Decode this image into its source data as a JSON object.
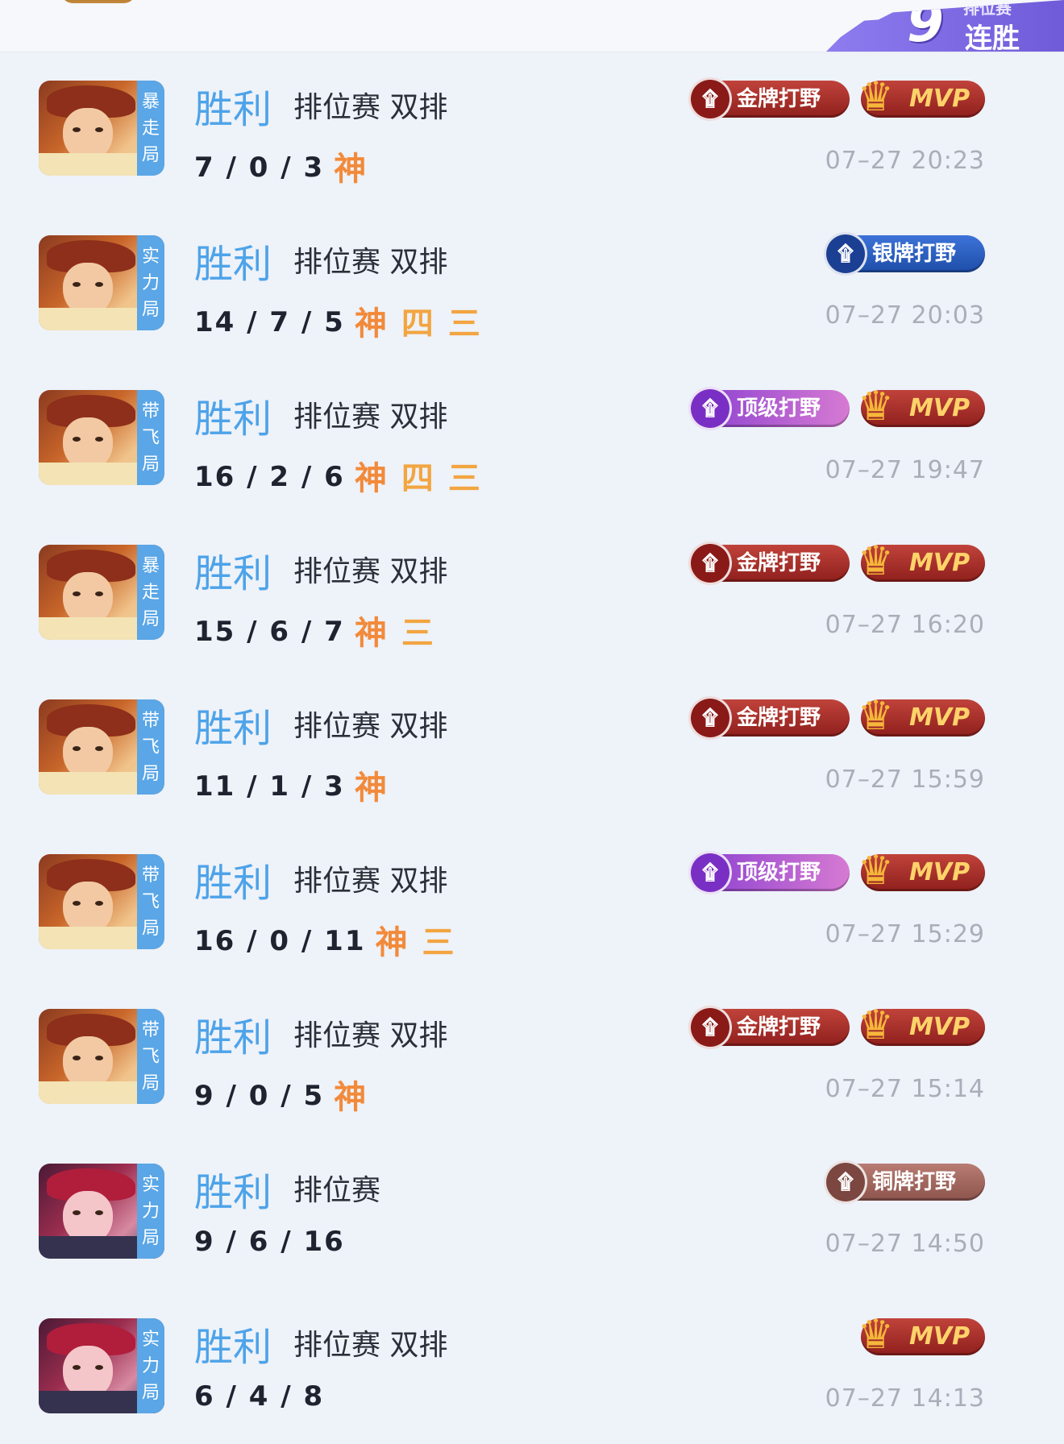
{
  "streak": {
    "number": "9",
    "sub": "排位赛",
    "label": "连胜"
  },
  "matches": [
    {
      "tag": [
        "暴",
        "走",
        "局"
      ],
      "hero": "gold",
      "result": "胜利",
      "mode": "排位赛 双排",
      "kda": "7 / 0 / 3",
      "extra": [
        "神"
      ],
      "badge": {
        "type": "gold",
        "label": "金牌打野"
      },
      "mvp": true,
      "time": "07–27 20:23"
    },
    {
      "tag": [
        "实",
        "力",
        "局"
      ],
      "hero": "gold",
      "result": "胜利",
      "mode": "排位赛 双排",
      "kda": "14 / 7 / 5",
      "extra": [
        "神",
        "四",
        "三"
      ],
      "badge": {
        "type": "silver",
        "label": "银牌打野"
      },
      "mvp": false,
      "time": "07–27 20:03"
    },
    {
      "tag": [
        "带",
        "飞",
        "局"
      ],
      "hero": "gold",
      "result": "胜利",
      "mode": "排位赛 双排",
      "kda": "16 / 2 / 6",
      "extra": [
        "神",
        "四",
        "三"
      ],
      "badge": {
        "type": "top",
        "label": "顶级打野"
      },
      "mvp": true,
      "time": "07–27 19:47"
    },
    {
      "tag": [
        "暴",
        "走",
        "局"
      ],
      "hero": "gold",
      "result": "胜利",
      "mode": "排位赛 双排",
      "kda": "15 / 6 / 7",
      "extra": [
        "神",
        "三"
      ],
      "badge": {
        "type": "gold",
        "label": "金牌打野"
      },
      "mvp": true,
      "time": "07–27 16:20"
    },
    {
      "tag": [
        "带",
        "飞",
        "局"
      ],
      "hero": "gold",
      "result": "胜利",
      "mode": "排位赛 双排",
      "kda": "11 / 1 / 3",
      "extra": [
        "神"
      ],
      "badge": {
        "type": "gold",
        "label": "金牌打野"
      },
      "mvp": true,
      "time": "07–27 15:59"
    },
    {
      "tag": [
        "带",
        "飞",
        "局"
      ],
      "hero": "gold",
      "result": "胜利",
      "mode": "排位赛 双排",
      "kda": "16 / 0 / 11",
      "extra": [
        "神",
        "三"
      ],
      "badge": {
        "type": "top",
        "label": "顶级打野"
      },
      "mvp": true,
      "time": "07–27 15:29"
    },
    {
      "tag": [
        "带",
        "飞",
        "局"
      ],
      "hero": "gold",
      "result": "胜利",
      "mode": "排位赛 双排",
      "kda": "9 / 0 / 5",
      "extra": [
        "神"
      ],
      "badge": {
        "type": "gold",
        "label": "金牌打野"
      },
      "mvp": true,
      "time": "07–27 15:14"
    },
    {
      "tag": [
        "实",
        "力",
        "局"
      ],
      "hero": "red",
      "result": "胜利",
      "mode": "排位赛",
      "kda": "9 / 6 / 16",
      "extra": [],
      "badge": {
        "type": "bronze",
        "label": "铜牌打野"
      },
      "mvp": false,
      "time": "07–27 14:50"
    },
    {
      "tag": [
        "实",
        "力",
        "局"
      ],
      "hero": "red",
      "result": "胜利",
      "mode": "排位赛 双排",
      "kda": "6 / 4 / 8",
      "extra": [],
      "badge": null,
      "mvp": true,
      "time": "07–27 14:13"
    }
  ],
  "mvp_label": "MVP",
  "colors": {
    "result": "#4da3e9",
    "tag_bg": "#5aa6e6",
    "timestamp": "#a9aeb8"
  },
  "icons": {
    "mvp": "trophy-icon",
    "jungle": "dragon-emblem-icon"
  }
}
